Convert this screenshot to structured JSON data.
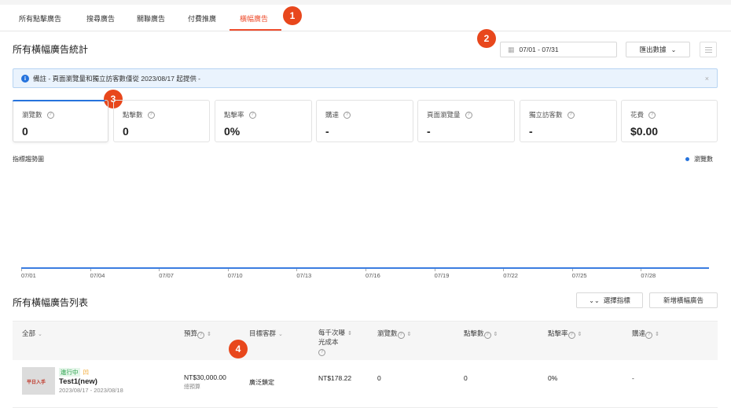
{
  "tabs": [
    {
      "label": "所有點擊廣告"
    },
    {
      "label": "搜尋廣告"
    },
    {
      "label": "關聯廣告"
    },
    {
      "label": "付費推廣"
    },
    {
      "label": "橫幅廣告"
    }
  ],
  "badges": [
    "1",
    "2",
    "3",
    "4"
  ],
  "stats_section": {
    "title": "所有橫幅廣告統計",
    "date_range": "07/01 - 07/31",
    "export_label": "匯出數據"
  },
  "notice": {
    "text": "備註 - 頁面瀏覽量和獨立訪客數僅從 2023/08/17 起提供 -",
    "close": "×"
  },
  "metrics": [
    {
      "label": "瀏覽數",
      "value": "0"
    },
    {
      "label": "點擊數",
      "value": "0"
    },
    {
      "label": "點擊率",
      "value": "0%"
    },
    {
      "label": "購達",
      "value": "-"
    },
    {
      "label": "頁面瀏覽量",
      "value": "-"
    },
    {
      "label": "獨立訪客數",
      "value": "-"
    },
    {
      "label": "花費",
      "value": "$0.00"
    }
  ],
  "trend": {
    "title": "指標趨勢圖",
    "legend": "瀏覽數",
    "xticks": [
      "07/01",
      "07/04",
      "07/07",
      "07/10",
      "07/13",
      "07/16",
      "07/19",
      "07/22",
      "07/25",
      "07/28"
    ]
  },
  "list_section": {
    "title": "所有橫幅廣告列表",
    "select_metrics": "選擇指標",
    "add_banner": "新增橫幅廣告"
  },
  "table": {
    "headers": {
      "all": "全部",
      "budget": "預算",
      "target": "目標客群",
      "cpm_line1": "每千次曝",
      "cpm_line2": "光成本",
      "impressions": "瀏覽數",
      "clicks": "點擊數",
      "ctr": "點擊率",
      "reach": "購達"
    },
    "rows": [
      {
        "thumb_text": "平日入手",
        "status": "進行中",
        "status2": "凹",
        "name": "Test1(new)",
        "dates": "2023/08/17 - 2023/08/18",
        "budget": "NT$30,000.00",
        "budget_sub": "總預算",
        "target": "廣泛鎖定",
        "cpm": "NT$178.22",
        "impressions": "0",
        "clicks": "0",
        "ctr": "0%",
        "reach": "-"
      }
    ]
  },
  "colors": {
    "accent": "#ee4d2d",
    "badge": "#e8471c",
    "blue": "#2673dd"
  }
}
